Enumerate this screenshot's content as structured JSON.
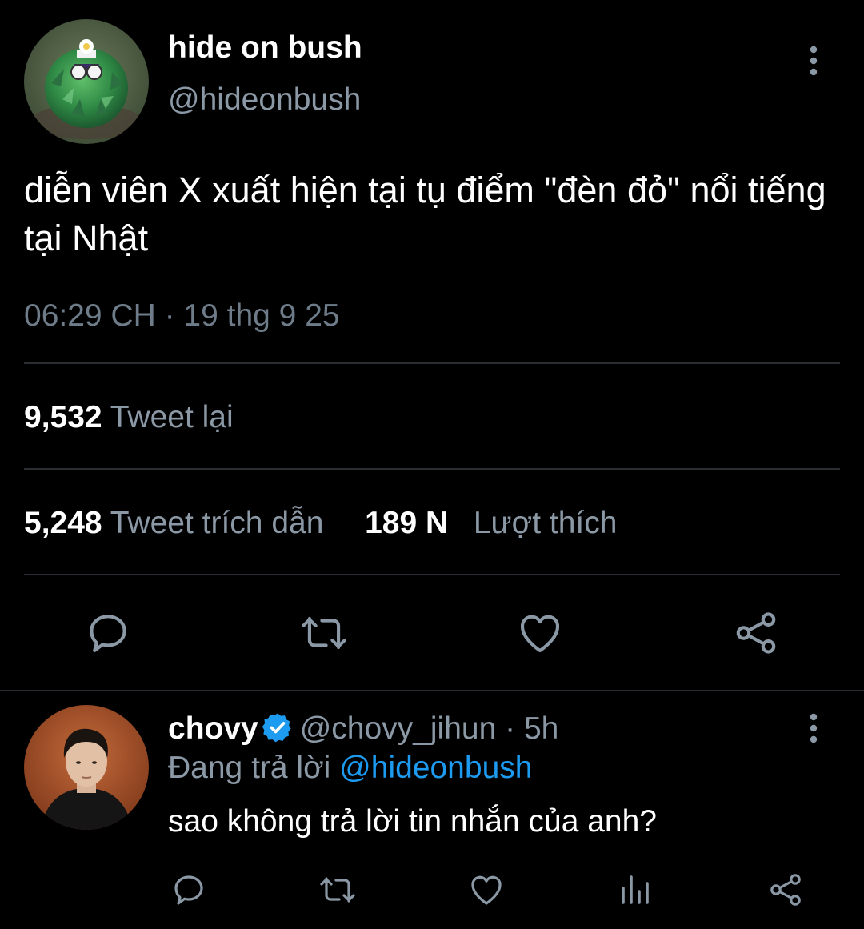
{
  "tweet": {
    "author": {
      "display_name": "hide on bush",
      "handle": "@hideonbush",
      "avatar_icon": "bush-avatar"
    },
    "text": "diễn viên X xuất hiện tại tụ điểm \"đèn đỏ\" nổi tiếng tại Nhật",
    "timestamp": "06:29 CH · 19 thg 9 25",
    "stats": {
      "retweets": {
        "count": "9,532",
        "label": "Tweet lại"
      },
      "quotes": {
        "count": "5,248",
        "label": "Tweet trích dẫn"
      },
      "likes": {
        "count": "189 N",
        "label": "Lượt thích"
      }
    },
    "actions": [
      "reply-icon",
      "retweet-icon",
      "like-icon",
      "share-icon"
    ]
  },
  "reply": {
    "author": {
      "display_name": "chovy",
      "handle": "@chovy_jihun",
      "verified": true,
      "avatar_icon": "portrait-avatar"
    },
    "time": "· 5h",
    "replying_label": "Đang trả lời",
    "replying_handle": "@hideonbush",
    "text": "sao không trả lời tin nhắn của anh?",
    "actions": [
      "reply-icon",
      "retweet-icon",
      "like-icon",
      "views-icon",
      "share-icon"
    ]
  },
  "colors": {
    "background": "#000000",
    "text_primary": "#ffffff",
    "text_secondary": "#8b98a5",
    "link": "#1d9bf0",
    "divider": "#2a2e33",
    "icon": "#8b98a5"
  }
}
